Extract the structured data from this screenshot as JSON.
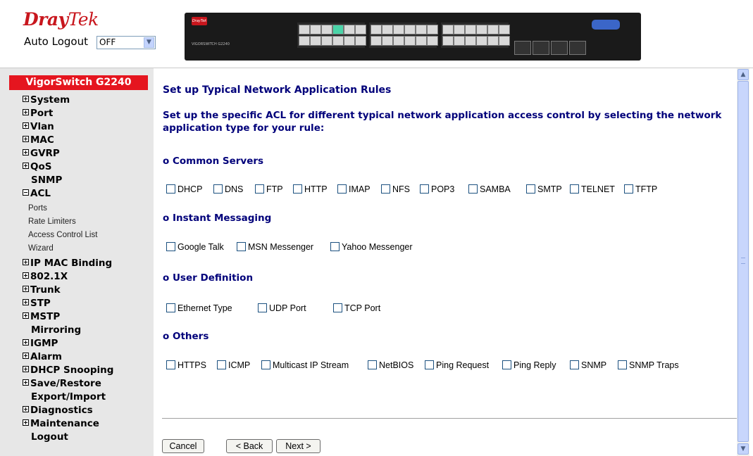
{
  "header": {
    "logo_dray": "Dray",
    "logo_tek": "Tek",
    "auto_logout_label": "Auto Logout",
    "auto_logout_value": "OFF",
    "device_badge": "DrayTek",
    "device_model": "VIGORSWITCH G2240"
  },
  "sidebar": {
    "title": "VigorSwitch G2240",
    "items": [
      {
        "label": "System"
      },
      {
        "label": "Port"
      },
      {
        "label": "Vlan"
      },
      {
        "label": "MAC"
      },
      {
        "label": "GVRP"
      },
      {
        "label": "QoS"
      },
      {
        "label": "SNMP"
      },
      {
        "label": "ACL"
      },
      {
        "label": "IP MAC Binding"
      },
      {
        "label": "802.1X"
      },
      {
        "label": "Trunk"
      },
      {
        "label": "STP"
      },
      {
        "label": "MSTP"
      },
      {
        "label": "Mirroring"
      },
      {
        "label": "IGMP"
      },
      {
        "label": "Alarm"
      },
      {
        "label": "DHCP Snooping"
      },
      {
        "label": "Save/Restore"
      },
      {
        "label": "Export/Import"
      },
      {
        "label": "Diagnostics"
      },
      {
        "label": "Maintenance"
      },
      {
        "label": "Logout"
      }
    ],
    "acl_sub": [
      "Ports",
      "Rate Limiters",
      "Access Control List",
      "Wizard"
    ]
  },
  "main": {
    "title": "Set up Typical Network Application Rules",
    "description": "Set up the specific ACL for different typical network application access control by selecting the network application type for your rule:",
    "sections": [
      {
        "heading": "o Common Servers",
        "options": [
          "DHCP",
          "DNS",
          "FTP",
          "HTTP",
          "IMAP",
          "NFS",
          "POP3",
          "SAMBA",
          "SMTP",
          "TELNET",
          "TFTP"
        ]
      },
      {
        "heading": "o Instant Messaging",
        "options": [
          "Google Talk",
          "MSN Messenger",
          "Yahoo Messenger"
        ]
      },
      {
        "heading": "o User Definition",
        "options": [
          "Ethernet Type",
          "UDP Port",
          "TCP Port"
        ]
      },
      {
        "heading": "o Others",
        "options": [
          "HTTPS",
          "ICMP",
          "Multicast IP Stream",
          "NetBIOS",
          "Ping Request",
          "Ping Reply",
          "SNMP",
          "SNMP Traps"
        ]
      }
    ],
    "buttons": {
      "cancel": "Cancel",
      "back": "< Back",
      "next": "Next >"
    }
  },
  "icons": {
    "expand": "plus-box-icon",
    "collapse": "minus-box-icon",
    "dropdown": "chevron-down-icon",
    "scroll_up": "scroll-up-arrow-icon",
    "scroll_down": "scroll-down-arrow-icon"
  },
  "colors": {
    "brand_red": "#c8161d",
    "sidebar_title_bg": "#e5151f",
    "heading_blue": "#00007a",
    "sidebar_bg": "#e7e7e7"
  }
}
